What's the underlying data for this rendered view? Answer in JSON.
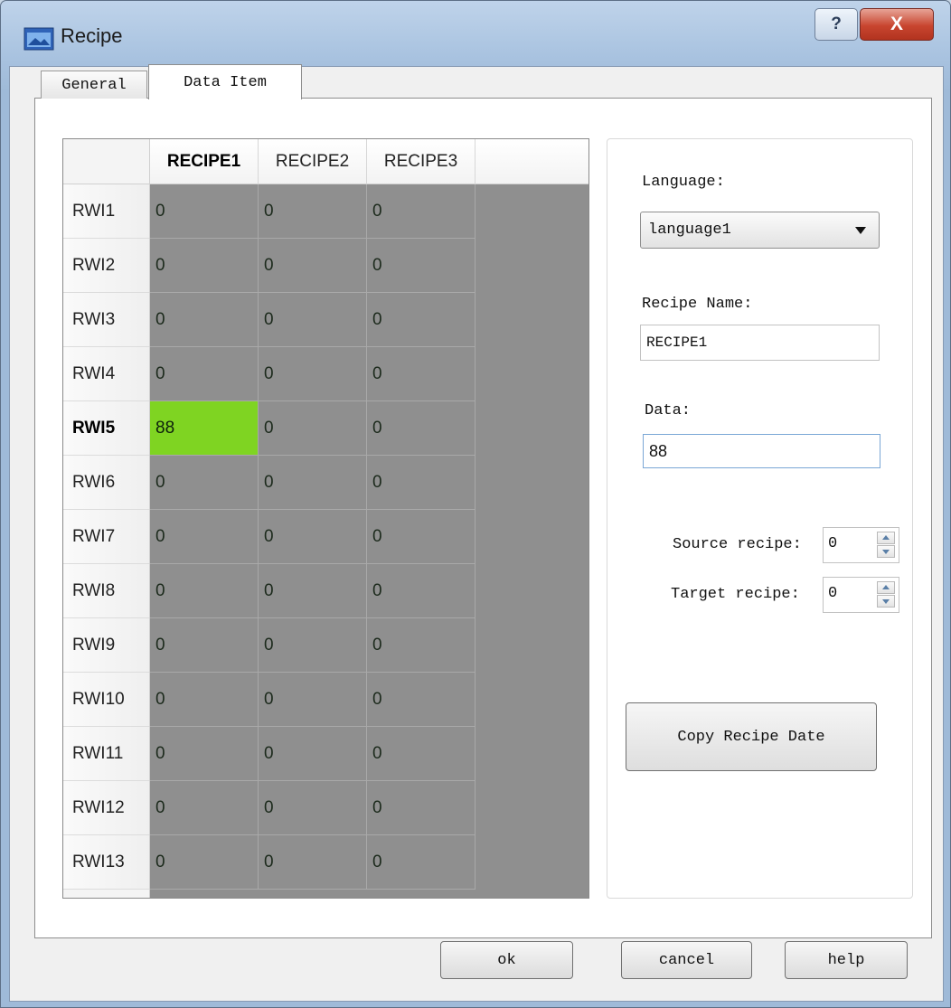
{
  "window": {
    "title": "Recipe",
    "help_glyph": "?",
    "close_glyph": "X"
  },
  "tabs": [
    {
      "label": "General",
      "active": false
    },
    {
      "label": "Data Item",
      "active": true
    }
  ],
  "grid": {
    "columns": [
      "RECIPE1",
      "RECIPE2",
      "RECIPE3"
    ],
    "rows": [
      {
        "label": "RWI1",
        "values": [
          "0",
          "0",
          "0"
        ]
      },
      {
        "label": "RWI2",
        "values": [
          "0",
          "0",
          "0"
        ]
      },
      {
        "label": "RWI3",
        "values": [
          "0",
          "0",
          "0"
        ]
      },
      {
        "label": "RWI4",
        "values": [
          "0",
          "0",
          "0"
        ]
      },
      {
        "label": "RWI5",
        "values": [
          "88",
          "0",
          "0"
        ]
      },
      {
        "label": "RWI6",
        "values": [
          "0",
          "0",
          "0"
        ]
      },
      {
        "label": "RWI7",
        "values": [
          "0",
          "0",
          "0"
        ]
      },
      {
        "label": "RWI8",
        "values": [
          "0",
          "0",
          "0"
        ]
      },
      {
        "label": "RWI9",
        "values": [
          "0",
          "0",
          "0"
        ]
      },
      {
        "label": "RWI10",
        "values": [
          "0",
          "0",
          "0"
        ]
      },
      {
        "label": "RWI11",
        "values": [
          "0",
          "0",
          "0"
        ]
      },
      {
        "label": "RWI12",
        "values": [
          "0",
          "0",
          "0"
        ]
      },
      {
        "label": "RWI13",
        "values": [
          "0",
          "0",
          "0"
        ]
      }
    ],
    "selected_row": 4,
    "selected_col": 0,
    "selected_color": "#7fd422"
  },
  "side": {
    "language_label": "Language:",
    "language_value": "language1",
    "recipe_name_label": "Recipe Name:",
    "recipe_name_value": "RECIPE1",
    "data_label": "Data:",
    "data_value": "88",
    "source_label": "Source recipe:",
    "source_value": "0",
    "target_label": "Target recipe:",
    "target_value": "0",
    "copy_button": "Copy Recipe Date"
  },
  "buttons": {
    "ok": "ok",
    "cancel": "cancel",
    "help": "help"
  }
}
